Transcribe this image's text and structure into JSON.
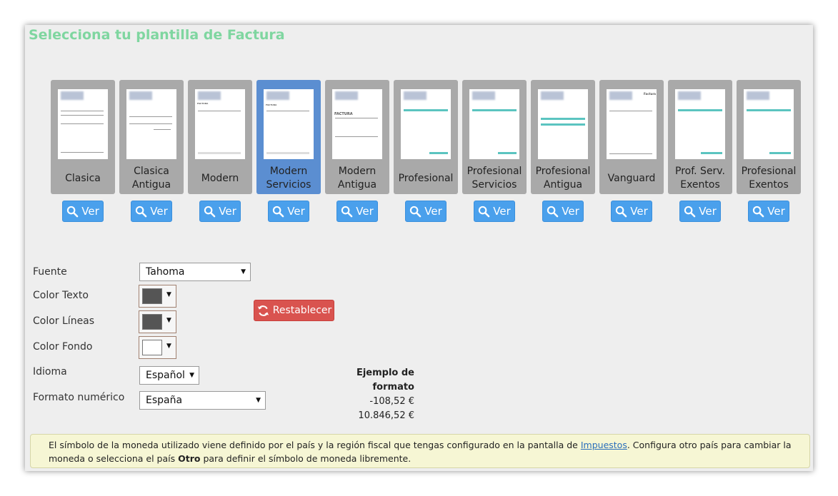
{
  "title": "Selecciona tu plantilla de Factura",
  "selected_template": "Modern Servicios",
  "templates": [
    {
      "name": "Clasica",
      "view_label": "Ver"
    },
    {
      "name": "Clasica Antigua",
      "view_label": "Ver"
    },
    {
      "name": "Modern",
      "view_label": "Ver"
    },
    {
      "name": "Modern Servicios",
      "view_label": "Ver"
    },
    {
      "name": "Modern Antigua",
      "view_label": "Ver"
    },
    {
      "name": "Profesional",
      "view_label": "Ver"
    },
    {
      "name": "Profesional Servicios",
      "view_label": "Ver"
    },
    {
      "name": "Profesional Antigua",
      "view_label": "Ver"
    },
    {
      "name": "Vanguard",
      "view_label": "Ver"
    },
    {
      "name": "Prof. Serv. Exentos",
      "view_label": "Ver"
    },
    {
      "name": "Profesional Exentos",
      "view_label": "Ver"
    }
  ],
  "thumb_texts": {
    "factura_upper": "FACTURA",
    "factura_title": "Factura"
  },
  "form": {
    "font_label": "Fuente",
    "font_value": "Tahoma",
    "text_color_label": "Color Texto",
    "text_color": "#555555",
    "line_color_label": "Color Líneas",
    "line_color": "#555555",
    "bg_color_label": "Color Fondo",
    "bg_color": "#ffffff",
    "language_label": "Idioma",
    "language_value": "Español",
    "number_format_label": "Formato numérico",
    "number_format_value": "España",
    "reset_label": "Restablecer"
  },
  "format_example": {
    "heading": "Ejemplo de formato",
    "negative": "-108,52 €",
    "positive": "10.846,52 €"
  },
  "notice": {
    "part1": "El símbolo de la moneda utilizado viene definido por el país y la región fiscal que tengas configurado en la pantalla de ",
    "link": "Impuestos",
    "part2": ". Configura otro país para cambiar la moneda o selecciona el país ",
    "bold": "Otro",
    "part3": " para definir el símbolo de moneda libremente."
  },
  "colors": {
    "title": "#7fd6a0",
    "tile": "#a9a9a9",
    "tile_selected": "#5b8ed1",
    "button_blue": "#4aa0ec",
    "button_red": "#d9534f",
    "notice_bg": "#f6f6d4"
  },
  "icons": {
    "view": "search-icon",
    "reset": "refresh-icon",
    "dropdown": "caret-down-icon"
  }
}
